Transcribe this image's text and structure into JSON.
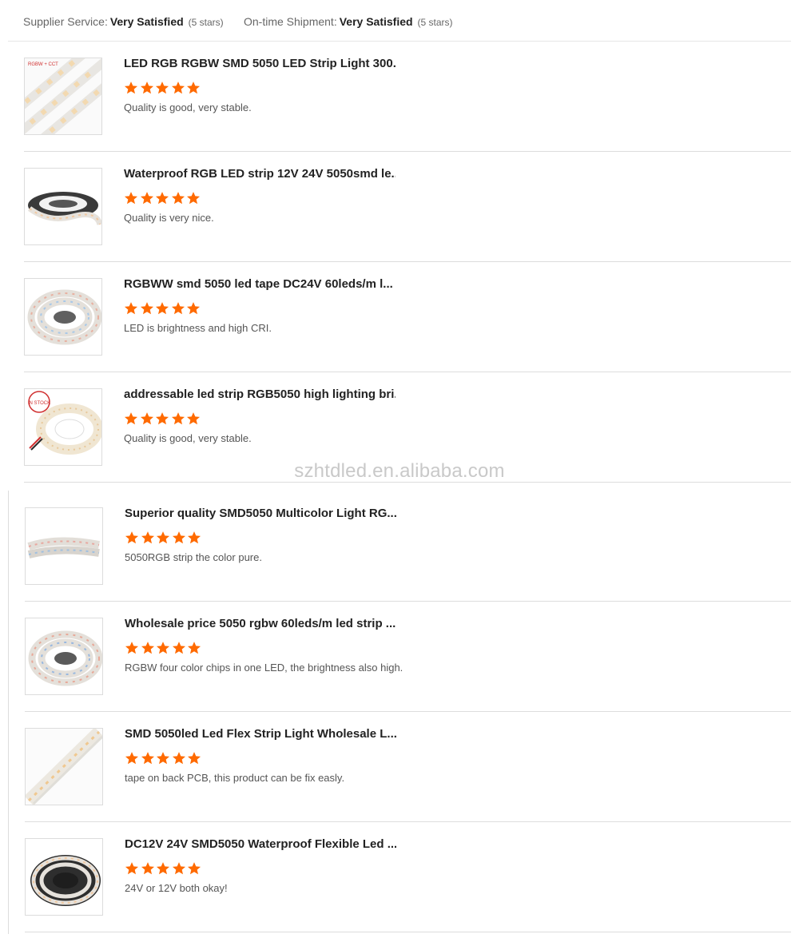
{
  "summary": {
    "supplier_service": {
      "label": "Supplier Service:",
      "value": "Very Satisfied",
      "count": "(5 stars)"
    },
    "ontime_shipment": {
      "label": "On-time Shipment:",
      "value": "Very Satisfied",
      "count": "(5 stars)"
    }
  },
  "star_color": "#ff6a00",
  "reviews": [
    {
      "title": "LED RGB RGBW SMD 5050 LED Strip Light 300...",
      "rating": 5,
      "comment": "Quality is good, very stable.",
      "thumb_label": "RGBW + CCT"
    },
    {
      "title": "Waterproof RGB LED strip 12V 24V 5050smd le...",
      "rating": 5,
      "comment": "Quality is very nice."
    },
    {
      "title": "RGBWW smd 5050 led tape DC24V 60leds/m l...",
      "rating": 5,
      "comment": "LED is brightness and high CRI."
    },
    {
      "title": "addressable led strip RGB5050 high lighting bri...",
      "rating": 5,
      "comment": "Quality is good, very stable.",
      "thumb_badge": "IN STOCK"
    },
    {
      "title": "Superior quality SMD5050 Multicolor Light RG...",
      "rating": 5,
      "comment": "5050RGB strip the color pure."
    },
    {
      "title": "Wholesale price 5050 rgbw 60leds/m led strip ...",
      "rating": 5,
      "comment": "RGBW four color chips in one LED, the brightness also high."
    },
    {
      "title": "SMD 5050led Led Flex Strip Light Wholesale L...",
      "rating": 5,
      "comment": "tape on back PCB, this product can be fix easly."
    },
    {
      "title": "DC12V 24V SMD5050 Waterproof Flexible Led ...",
      "rating": 5,
      "comment": "24V or 12V both okay!"
    }
  ],
  "watermark": "szhtdled.en.alibaba.com"
}
